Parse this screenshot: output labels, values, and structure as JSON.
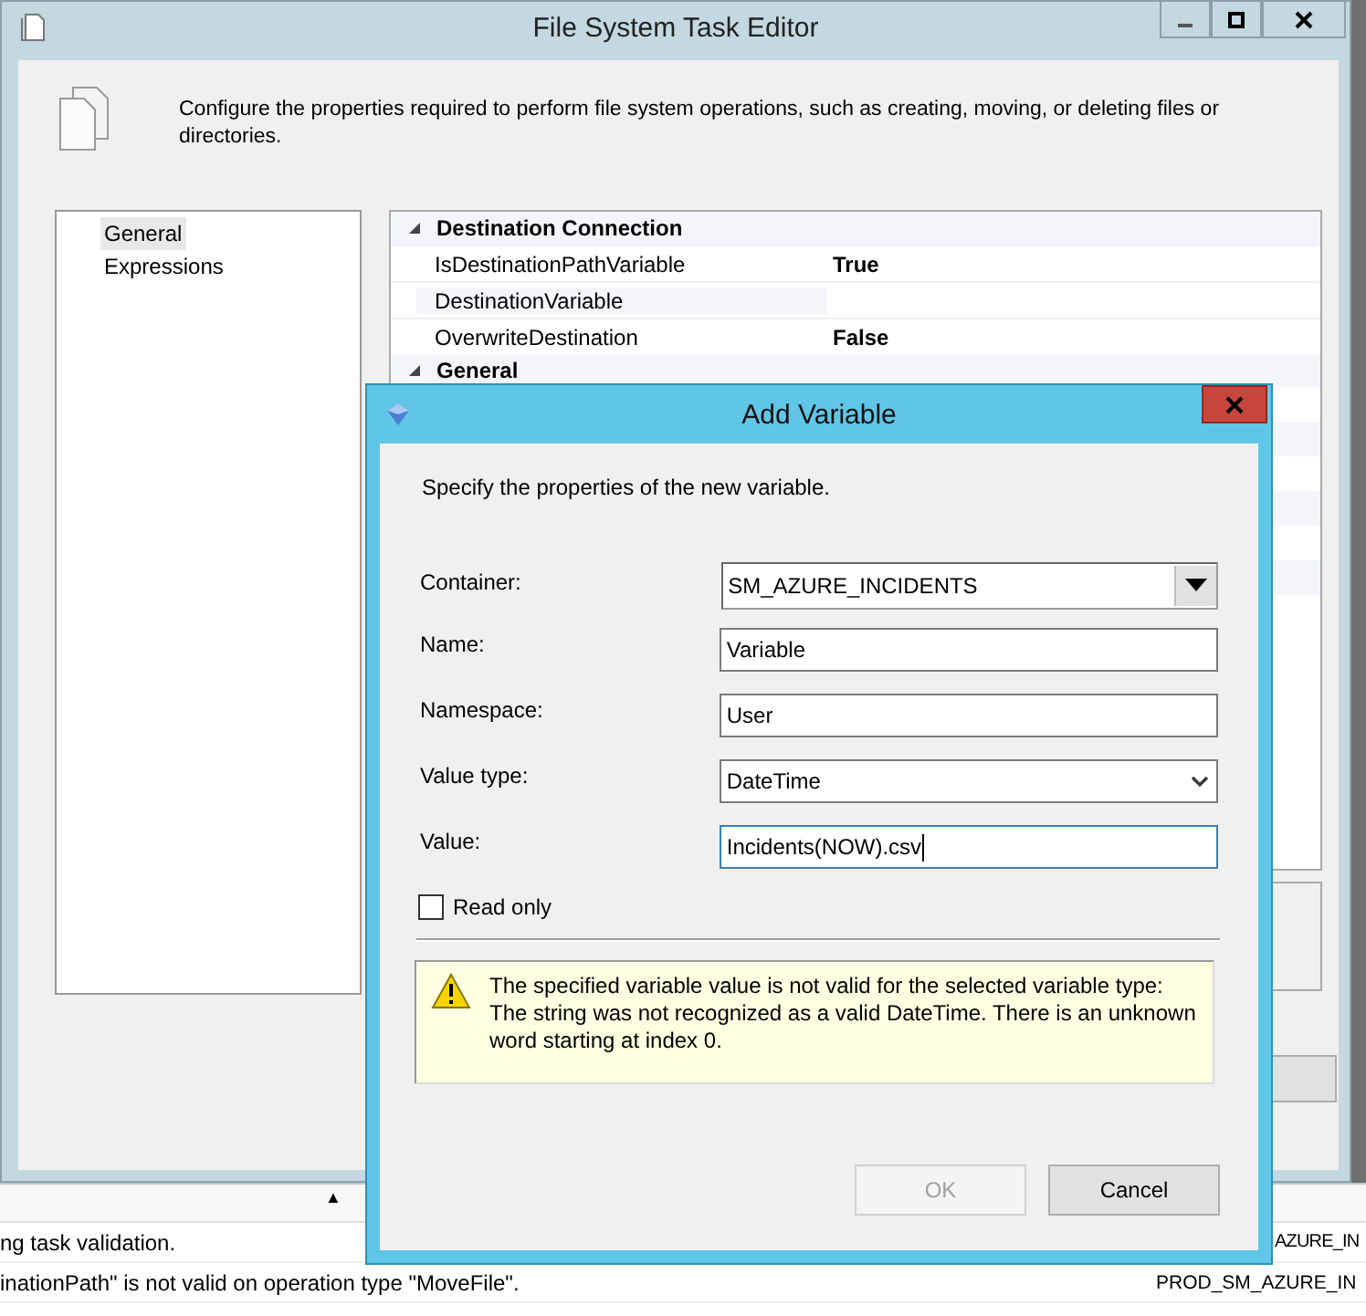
{
  "main_window": {
    "title": "File System Task Editor",
    "description": "Configure the properties required to perform file system operations, such as creating, moving, or deleting files or directories.",
    "nav_items": [
      {
        "label": "General",
        "selected": true
      },
      {
        "label": "Expressions",
        "selected": false
      }
    ],
    "property_grid": {
      "categories": [
        {
          "name": "Destination Connection",
          "expanded": true,
          "properties": [
            {
              "name": "IsDestinationPathVariable",
              "value": "True"
            },
            {
              "name": "DestinationVariable"
            },
            {
              "name": "OverwriteDestination",
              "value": "False"
            }
          ]
        },
        {
          "name": "General",
          "expanded": true
        }
      ]
    }
  },
  "dialog": {
    "title": "Add Variable",
    "instruction": "Specify the properties of the new variable.",
    "fields": [
      {
        "label": "Container:",
        "kind": "combo",
        "value": "SM_AZURE_INCIDENTS",
        "focused": false
      },
      {
        "label": "Name:",
        "kind": "text",
        "value": "Variable",
        "focused": false
      },
      {
        "label": "Namespace:",
        "kind": "text",
        "value": "User",
        "focused": false
      },
      {
        "label": "Value type:",
        "kind": "select",
        "value": "DateTime",
        "focused": false
      },
      {
        "label": "Value:",
        "kind": "text",
        "value": "Incidents(NOW).csv",
        "focused": true
      }
    ],
    "read_only": {
      "label": "Read only",
      "checked": false
    },
    "message": "The specified variable value is not valid for the selected variable type: The string was not recognized as a valid DateTime. There is an unknown word starting at index 0.",
    "buttons": [
      {
        "label": "OK",
        "disabled": true
      },
      {
        "label": "Cancel",
        "disabled": false
      }
    ]
  },
  "output": {
    "sort_indicator": "▲",
    "rows": [
      {
        "message": "ng task validation.",
        "source": "AZURE_IN"
      },
      {
        "message": "inationPath\" is not valid on operation type \"MoveFile\".",
        "source": "PROD_SM_AZURE_IN"
      }
    ]
  }
}
